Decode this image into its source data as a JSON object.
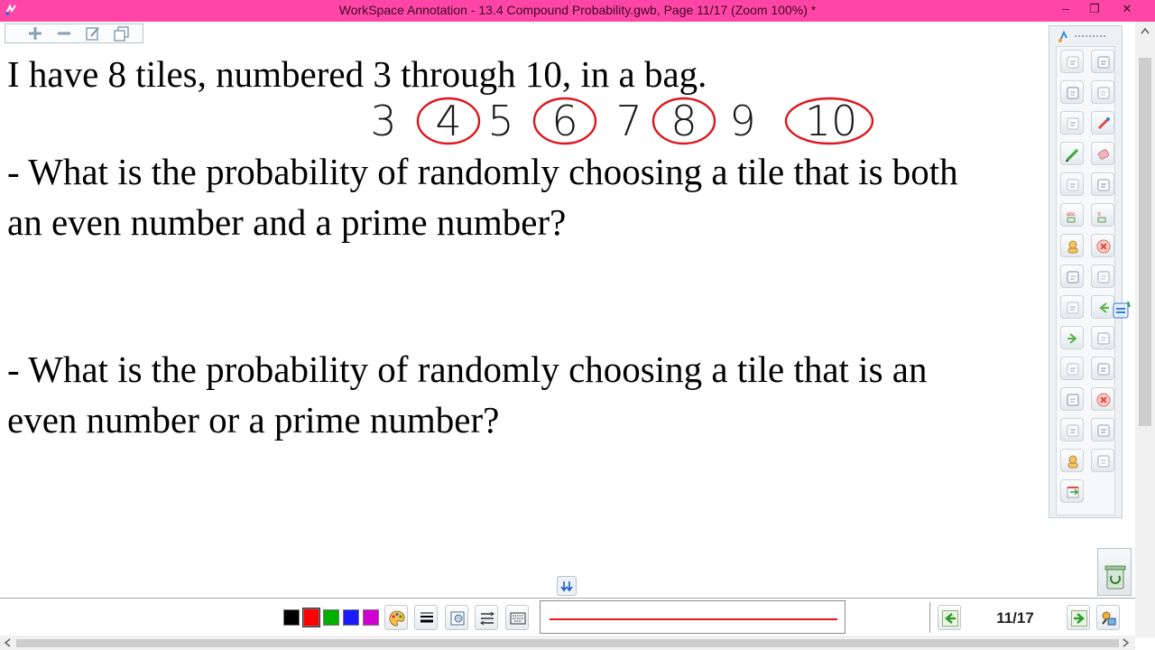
{
  "window": {
    "title": "WorkSpace Annotation - 13.4 Compound Probability.gwb, Page 11/17  (Zoom 100%) *",
    "controls": {
      "minimize": "–",
      "restore": "❐",
      "close": "✕"
    }
  },
  "page": {
    "line1": "I have 8 tiles, numbered 3 through 10, in a bag.",
    "q1_line1": "- What is the probability of randomly choosing a tile that is both",
    "q1_line2": "an even number and a prime number?",
    "q2_line1": "- What is the probability of randomly choosing a tile that is an",
    "q2_line2": "even number or a prime number?",
    "handwritten_numbers": [
      "3",
      "4",
      "5",
      "6",
      "7",
      "8",
      "9",
      "10"
    ],
    "circled_numbers": [
      "4",
      "6",
      "8",
      "10"
    ]
  },
  "bottom_toolbar": {
    "colors": [
      "#000000",
      "#ff0000",
      "#00b000",
      "#1a1aff",
      "#d000d0"
    ],
    "selected_color": "#ff0000",
    "line_color": "#e8151b",
    "page_indicator": "11/17"
  },
  "palette": {
    "icons": [
      "add-page-icon",
      "remove-page-icon",
      "mouse-icon",
      "copy-icon",
      "select-icon",
      "magic-pen-icon",
      "pen-icon",
      "eraser-icon",
      "highlighter-icon",
      "lines-icon",
      "text-recognition-icon",
      "shape-recognition-icon",
      "paint-bucket-icon",
      "clear-icon",
      "blank-page-icon",
      "new-page-icon",
      "screen-capture-icon",
      "previous-page-icon",
      "next-page-icon",
      "table-icon",
      "save-icon",
      "gallery-icon",
      "attachment-icon",
      "close-circle-icon",
      "camera-icon",
      "screenshot-icon",
      "user-icon",
      "ruler-icon",
      "exit-icon"
    ]
  }
}
